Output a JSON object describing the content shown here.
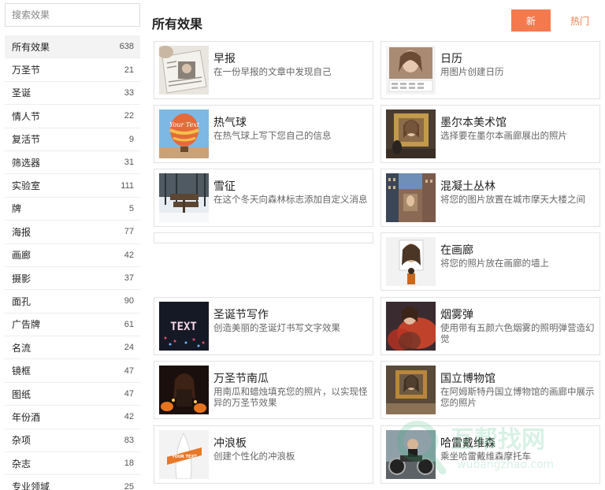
{
  "search": {
    "placeholder": "搜索效果"
  },
  "categories": [
    {
      "name": "所有效果",
      "count": "638"
    },
    {
      "name": "万圣节",
      "count": "21"
    },
    {
      "name": "圣诞",
      "count": "33"
    },
    {
      "name": "情人节",
      "count": "22"
    },
    {
      "name": "复活节",
      "count": "9"
    },
    {
      "name": "筛选器",
      "count": "31"
    },
    {
      "name": "实验室",
      "count": "111"
    },
    {
      "name": "牌",
      "count": "5"
    },
    {
      "name": "海报",
      "count": "77"
    },
    {
      "name": "画廊",
      "count": "42"
    },
    {
      "name": "摄影",
      "count": "37"
    },
    {
      "name": "面孔",
      "count": "90"
    },
    {
      "name": "广告牌",
      "count": "61"
    },
    {
      "name": "名流",
      "count": "24"
    },
    {
      "name": "镜框",
      "count": "47"
    },
    {
      "name": "图纸",
      "count": "47"
    },
    {
      "name": "年份酒",
      "count": "42"
    },
    {
      "name": "杂项",
      "count": "83"
    },
    {
      "name": "杂志",
      "count": "18"
    },
    {
      "name": "专业领域",
      "count": "25"
    }
  ],
  "main": {
    "title": "所有效果",
    "sort_new": "新",
    "sort_hot": "热门",
    "accent": "#f47a4e"
  },
  "effects": [
    {
      "title": "早报",
      "desc": "在一份早报的文章中发现自己",
      "icon": "newspaper-thumbnail"
    },
    {
      "title": "日历",
      "desc": "用图片创建日历",
      "icon": "calendar-thumbnail"
    },
    {
      "title": "热气球",
      "desc": "在热气球上写下您自己的信息",
      "icon": "balloon-thumbnail",
      "thumb_text": "Your Text"
    },
    {
      "title": "墨尔本美术馆",
      "desc": "选择要在墨尔本画廊展出的照片",
      "icon": "gallery-thumbnail"
    },
    {
      "title": "雪征",
      "desc": "在这个冬天向森林标志添加自定义消息",
      "icon": "snow-sign-thumbnail"
    },
    {
      "title": "混凝土丛林",
      "desc": "将您的图片放置在城市摩天大楼之间",
      "icon": "city-thumbnail"
    },
    {
      "title": "在画廊",
      "desc": "将您的照片放在画廊的墙上",
      "icon": "wall-frame-thumbnail"
    },
    {
      "title": "圣诞节写作",
      "desc": "创造美丽的圣诞灯书写文字效果",
      "icon": "lights-text-thumbnail",
      "thumb_text": "TEXT"
    },
    {
      "title": "烟雾弹",
      "desc": "使用带有五颜六色烟雾的照明弹营造幻觉",
      "icon": "smoke-thumbnail"
    },
    {
      "title": "万圣节南瓜",
      "desc": "用南瓜和蜡烛填充您的照片，以实现怪异的万圣节效果",
      "icon": "pumpkin-thumbnail"
    },
    {
      "title": "国立博物馆",
      "desc": "在阿姆斯特丹国立博物馆的画廊中展示您的照片",
      "icon": "museum-thumbnail"
    },
    {
      "title": "冲浪板",
      "desc": "创建个性化的冲浪板",
      "icon": "surfboard-thumbnail",
      "thumb_text": "YOUR TEXT"
    },
    {
      "title": "哈雷戴维森",
      "desc": "乘坐哈雷戴维森摩托车",
      "icon": "motorcycle-thumbnail"
    }
  ],
  "watermark": {
    "text": "互帮找网",
    "sub": "wubangzhao.com"
  }
}
